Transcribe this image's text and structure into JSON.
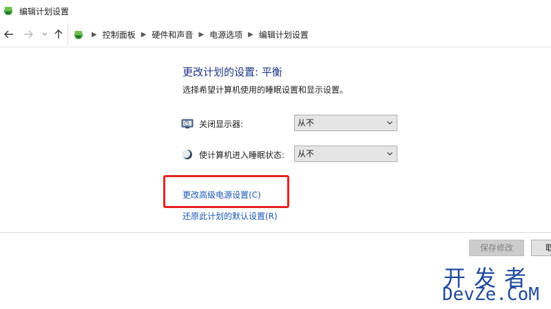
{
  "window": {
    "title": "编辑计划设置"
  },
  "nav": {
    "back_icon": "arrow-left-icon",
    "forward_icon": "arrow-right-icon",
    "recent_icon": "chevron-down-icon",
    "up_icon": "arrow-up-icon"
  },
  "breadcrumb": [
    "控制面板",
    "硬件和声音",
    "电源选项",
    "编辑计划设置"
  ],
  "main": {
    "heading": "更改计划的设置: 平衡",
    "subtext": "选择希望计算机使用的睡眠设置和显示设置。",
    "settings": [
      {
        "label": "关闭显示器:",
        "value": "从不",
        "icon": "monitor-icon"
      },
      {
        "label": "使计算机进入睡眠状态:",
        "value": "从不",
        "icon": "moon-icon"
      }
    ],
    "links": {
      "advanced": "更改高级电源设置(C)",
      "restore": "还原此计划的默认设置(R)"
    }
  },
  "footer": {
    "save_label": "保存修改",
    "cancel_label": "取消"
  },
  "watermark": {
    "cn": "开发者",
    "en": "DevZe.CoM"
  },
  "colors": {
    "heading": "#1e3287",
    "link": "#1a57b0",
    "highlight": "#e8211f",
    "watermark": "#1f4a9c"
  }
}
